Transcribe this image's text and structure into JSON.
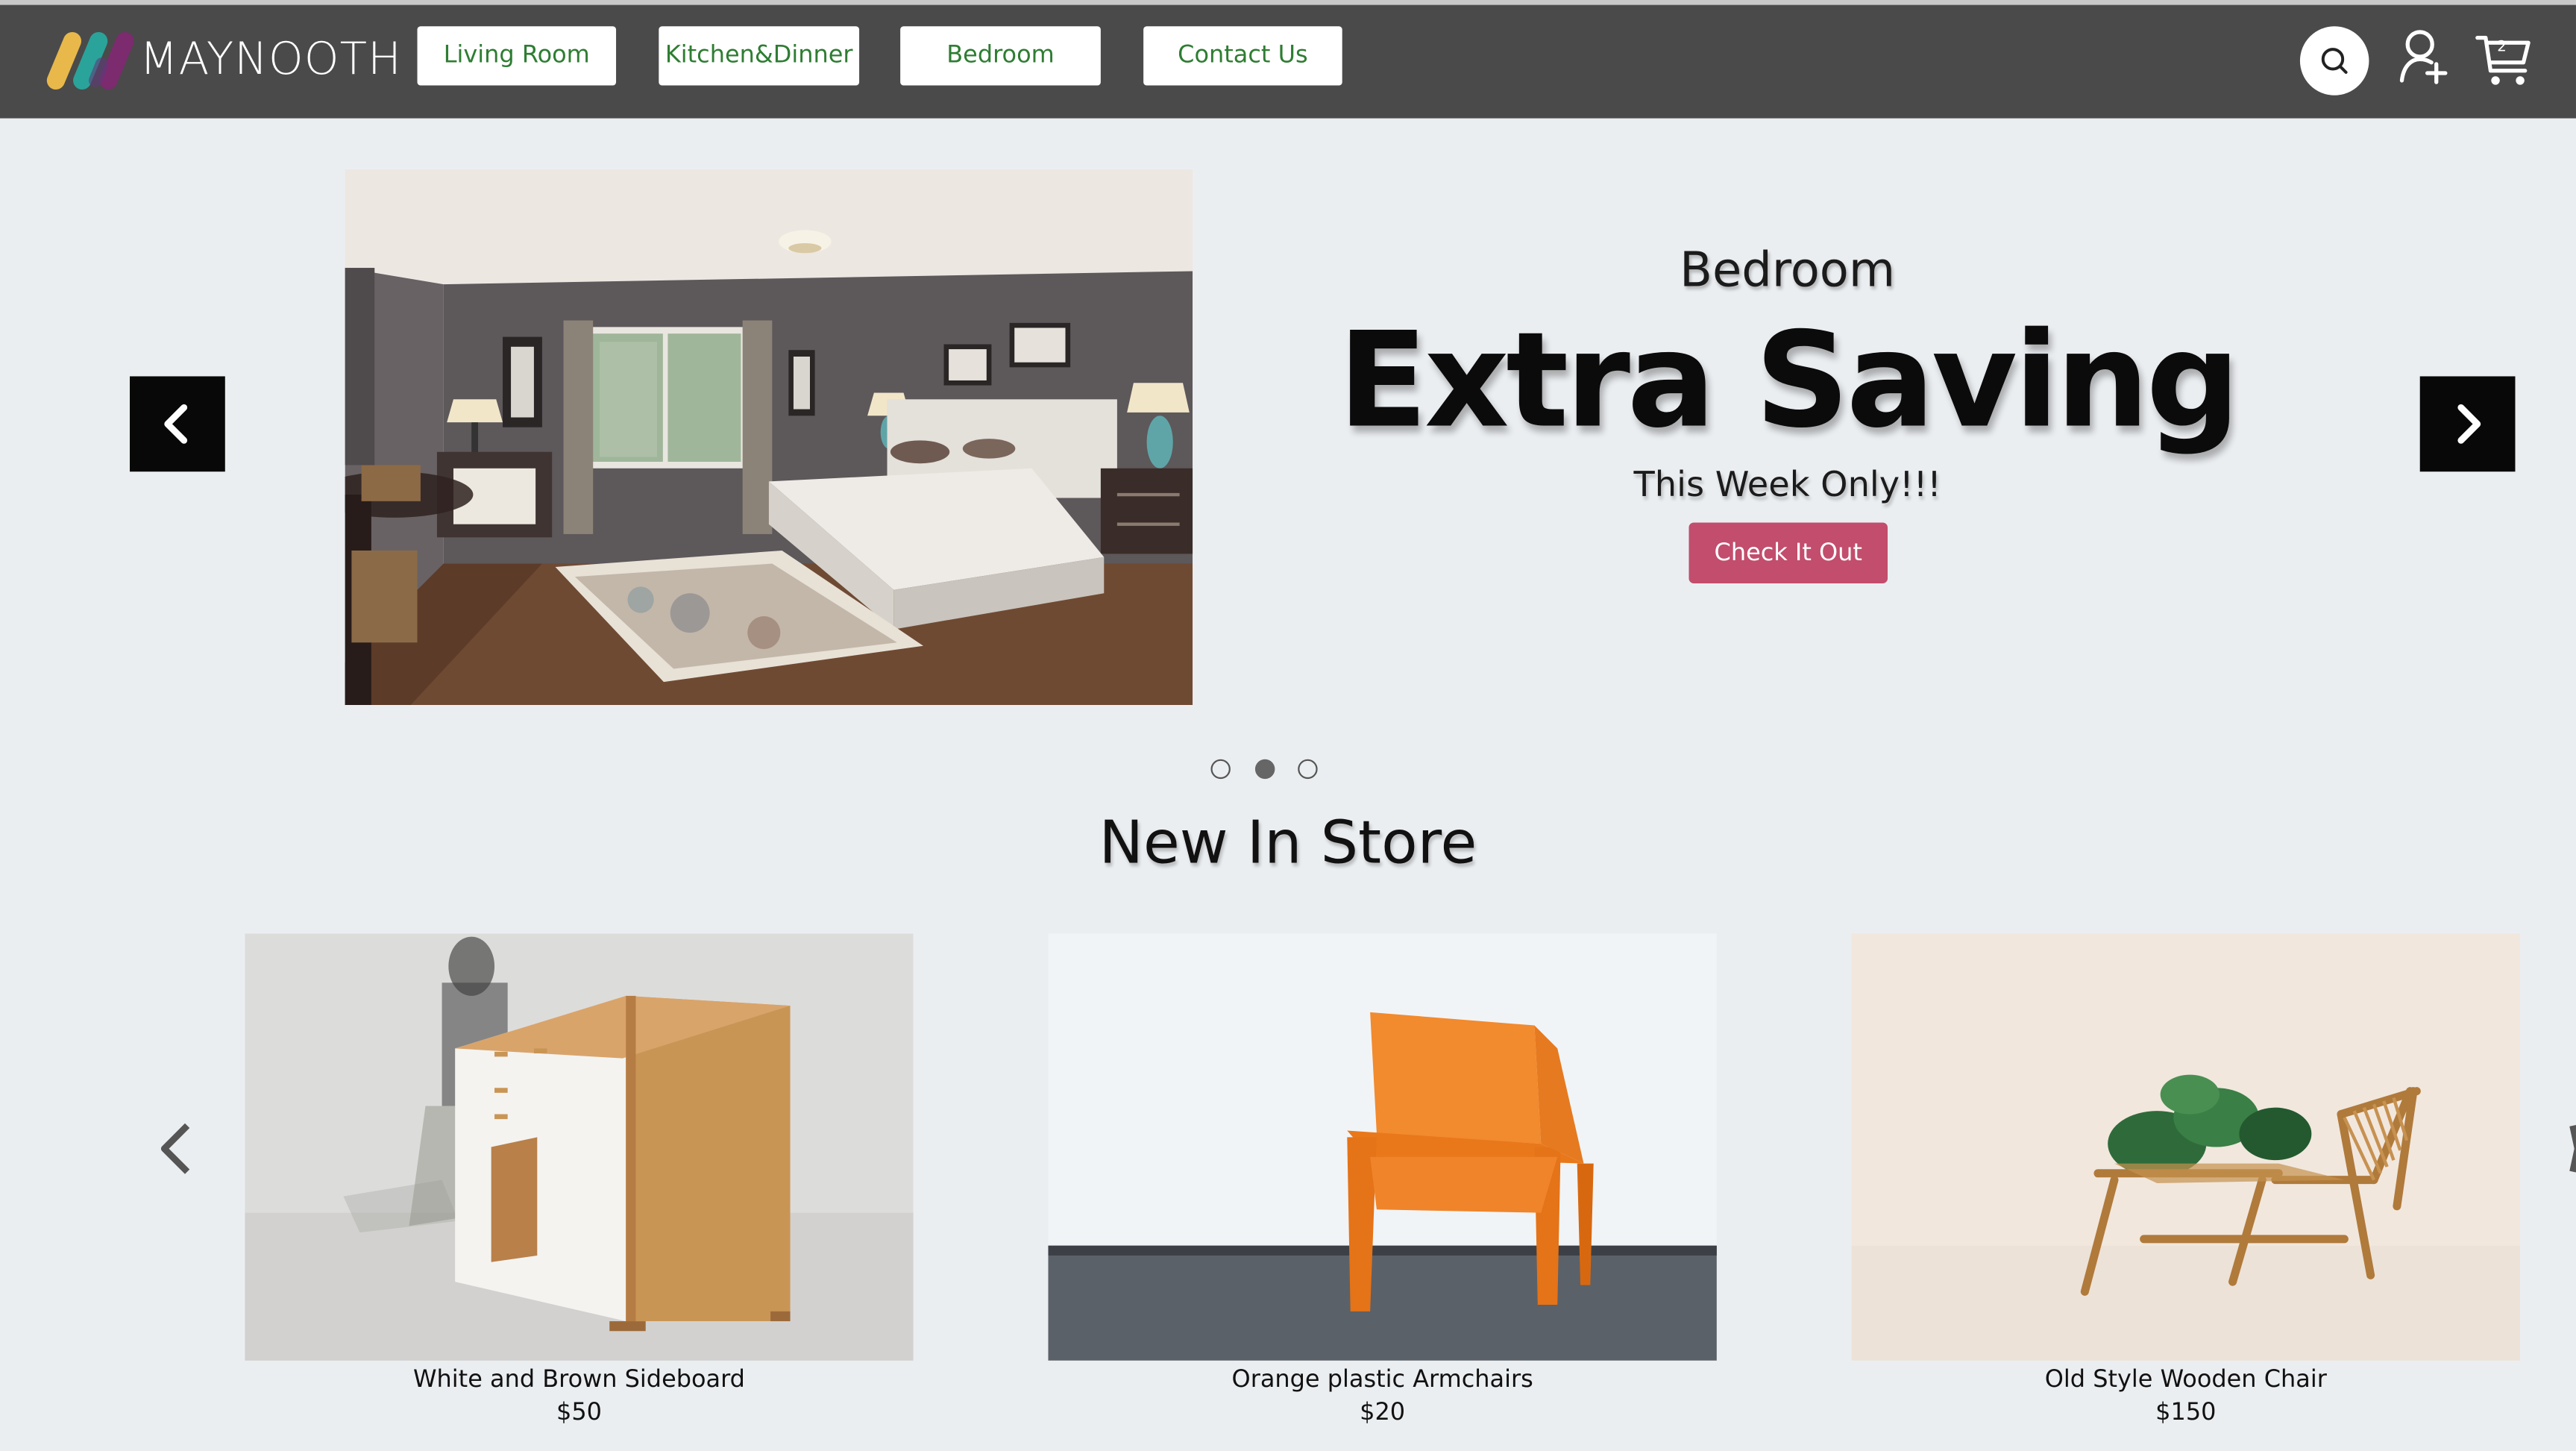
{
  "brand": {
    "name": "MAYNOOTH",
    "colors": [
      "#e8b84a",
      "#2aa39a",
      "#7b2b6e"
    ]
  },
  "nav": {
    "items": [
      {
        "label": "Living Room"
      },
      {
        "label": "Kitchen&Dinner"
      },
      {
        "label": "Bedroom"
      },
      {
        "label": "Contact Us"
      }
    ]
  },
  "header_icons": {
    "search": "search-icon",
    "account": "add-user-icon",
    "cart": "cart-icon",
    "cart_count": "2"
  },
  "hero": {
    "category": "Bedroom",
    "headline": "Extra Saving",
    "tagline": "This Week Only!!!",
    "cta_label": "Check It Out",
    "cta_color": "#c24d6c",
    "slide_count": 3,
    "active_slide": 2
  },
  "new_in_store": {
    "title": "New In Store",
    "products": [
      {
        "name": "White and Brown Sideboard",
        "price": "$50"
      },
      {
        "name": "Orange plastic Armchairs",
        "price": "$20"
      },
      {
        "name": "Old Style Wooden Chair",
        "price": "$150"
      }
    ]
  },
  "colors": {
    "header_bg": "#4a4a4a",
    "page_bg": "#ebeef1",
    "nav_text": "#2e7d32"
  }
}
